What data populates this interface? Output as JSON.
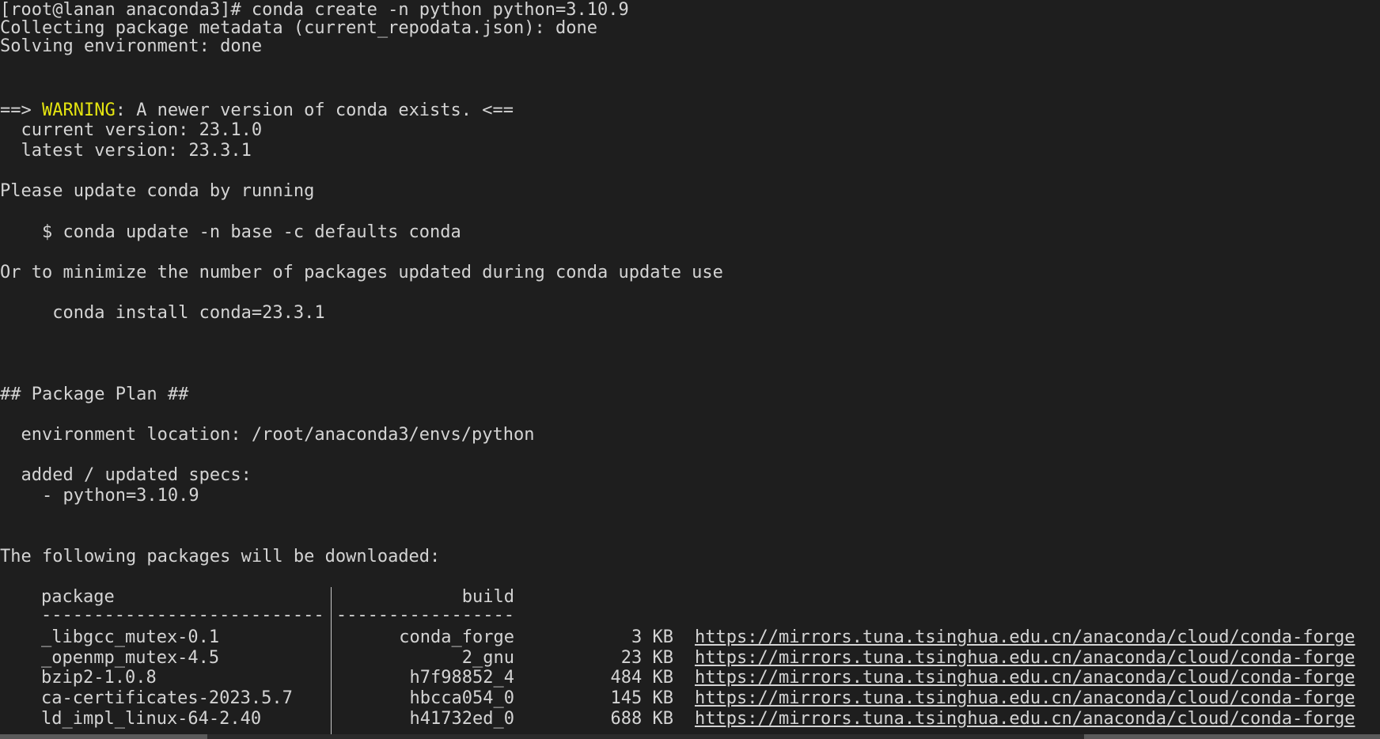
{
  "terminal": {
    "line_prompt": "[root@lanan anaconda3]# conda create -n python python=3.10.9",
    "line_collect": "Collecting package metadata (current_repodata.json): done",
    "line_solve": "Solving environment: done",
    "warn_prefix": "==> ",
    "warn_word": "WARNING",
    "warn_rest": ": A newer version of conda exists. <==",
    "line_current": "  current version: 23.1.0",
    "line_latest": "  latest version: 23.3.1",
    "line_please": "Please update conda by running",
    "line_update_cmd": "    $ conda update -n base -c defaults conda",
    "line_minimize": "Or to minimize the number of packages updated during conda update use",
    "line_install_cmd": "     conda install conda=23.3.1",
    "line_plan": "## Package Plan ##",
    "line_env_loc": "  environment location: /root/anaconda3/envs/python",
    "line_specs": "  added / updated specs:",
    "line_spec_item": "    - python=3.10.9",
    "line_following": "The following packages will be downloaded:",
    "table": {
      "header_package": "package",
      "header_build": "build",
      "rule_left": "---------------------------",
      "rule_right": "-----------------",
      "rows": [
        {
          "pkg": "_libgcc_mutex-0.1",
          "build": "conda_forge",
          "size": "3 KB",
          "url": "https://mirrors.tuna.tsinghua.edu.cn/anaconda/cloud/conda-forge"
        },
        {
          "pkg": "_openmp_mutex-4.5",
          "build": "2_gnu",
          "size": "23 KB",
          "url": "https://mirrors.tuna.tsinghua.edu.cn/anaconda/cloud/conda-forge"
        },
        {
          "pkg": "bzip2-1.0.8",
          "build": "h7f98852_4",
          "size": "484 KB",
          "url": "https://mirrors.tuna.tsinghua.edu.cn/anaconda/cloud/conda-forge"
        },
        {
          "pkg": "ca-certificates-2023.5.7",
          "build": "hbcca054_0",
          "size": "145 KB",
          "url": "https://mirrors.tuna.tsinghua.edu.cn/anaconda/cloud/conda-forge"
        },
        {
          "pkg": "ld_impl_linux-64-2.40",
          "build": "h41732ed_0",
          "size": "688 KB",
          "url": "https://mirrors.tuna.tsinghua.edu.cn/anaconda/cloud/conda-forge"
        }
      ]
    }
  },
  "colors": {
    "background": "#1e1e1e",
    "text": "#d4d4d4",
    "warning": "#e5e510"
  }
}
